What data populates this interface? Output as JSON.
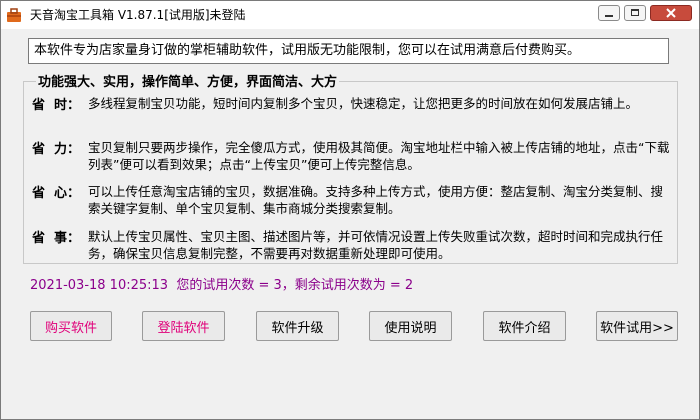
{
  "window": {
    "title": "天音淘宝工具箱 V1.87.1[试用版]未登陆"
  },
  "banner": "本软件专为店家量身订做的掌柜辅助软件，试用版无功能限制，您可以在试用满意后付费购买。",
  "features": {
    "group_title": "功能强大、实用，操作简单、方便，界面简洁、大方",
    "items": [
      {
        "label": "省  时：",
        "text": "多线程复制宝贝功能，短时间内复制多个宝贝，快速稳定，让您把更多的时间放在如何发展店铺上。"
      },
      {
        "label": "省  力：",
        "text": "宝贝复制只要两步操作，完全傻瓜方式，使用极其简便。淘宝地址栏中输入被上传店铺的地址，点击“下载列表”便可以看到效果；点击“上传宝贝”便可上传完整信息。"
      },
      {
        "label": "省  心：",
        "text": "可以上传任意淘宝店铺的宝贝，数据准确。支持多种上传方式，使用方便：整店复制、淘宝分类复制、搜索关键字复制、单个宝贝复制、集市商城分类搜索复制。"
      },
      {
        "label": "省  事：",
        "text": "默认上传宝贝属性、宝贝主图、描述图片等，并可依情况设置上传失败重试次数，超时时间和完成执行任务，确保宝贝信息复制完整，不需要再对数据重新处理即可使用。"
      }
    ]
  },
  "status": {
    "datetime": "2021-03-18 10:25:13",
    "trial_text": "您的试用次数 = 3，剩余试用次数为 = 2"
  },
  "buttons": {
    "buy": "购买软件",
    "login": "登陆软件",
    "upgrade": "软件升级",
    "manual": "使用说明",
    "intro": "软件介绍",
    "trial": "软件试用>>"
  },
  "colors": {
    "accent_pink": "#e0007a",
    "status_purple": "#8b008b",
    "close_red": "#c74b3c"
  },
  "icons": {
    "app": "toolbox-icon",
    "minimize": "minimize-icon",
    "maximize": "maximize-icon",
    "close": "close-icon"
  }
}
